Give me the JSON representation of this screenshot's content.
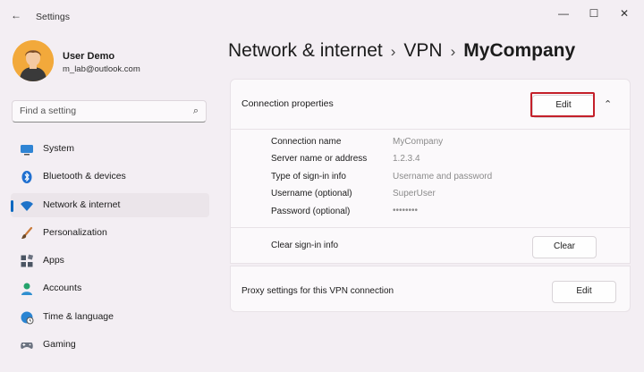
{
  "window": {
    "title": "Settings",
    "back_glyph": "←",
    "minimize_glyph": "—",
    "maximize_glyph": "☐",
    "close_glyph": "✕"
  },
  "user": {
    "name": "User Demo",
    "email": "m_lab@outlook.com"
  },
  "search": {
    "placeholder": "Find a setting",
    "icon": "search-icon"
  },
  "sidebar": {
    "items": [
      {
        "label": "System",
        "icon": "system-icon",
        "color": "#2f84d4"
      },
      {
        "label": "Bluetooth & devices",
        "icon": "bluetooth-icon",
        "color": "#1f6fd0"
      },
      {
        "label": "Network & internet",
        "icon": "wifi-icon",
        "color": "#1e73c9",
        "active": true
      },
      {
        "label": "Personalization",
        "icon": "brush-icon",
        "color": "#c97a3a"
      },
      {
        "label": "Apps",
        "icon": "apps-icon",
        "color": "#4b5563"
      },
      {
        "label": "Accounts",
        "icon": "accounts-icon",
        "color": "#25a36c"
      },
      {
        "label": "Time & language",
        "icon": "globe-icon",
        "color": "#2a84d2"
      },
      {
        "label": "Gaming",
        "icon": "gamepad-icon",
        "color": "#6b7280"
      }
    ]
  },
  "breadcrumb": {
    "items": [
      "Network & internet",
      "VPN",
      "MyCompany"
    ],
    "separator": "›"
  },
  "connection_properties": {
    "title": "Connection properties",
    "edit_label": "Edit",
    "collapse_glyph": "⌃",
    "properties": [
      {
        "label": "Connection name",
        "value": "MyCompany"
      },
      {
        "label": "Server name or address",
        "value": "1.2.3.4"
      },
      {
        "label": "Type of sign-in info",
        "value": "Username and password"
      },
      {
        "label": "Username (optional)",
        "value": "SuperUser"
      },
      {
        "label": "Password (optional)",
        "value": "••••••••"
      }
    ],
    "clear_label": "Clear sign-in info",
    "clear_button": "Clear"
  },
  "proxy": {
    "label": "Proxy settings for this VPN connection",
    "edit_label": "Edit"
  },
  "colors": {
    "accent": "#0067c0",
    "highlight": "#c4202a"
  }
}
